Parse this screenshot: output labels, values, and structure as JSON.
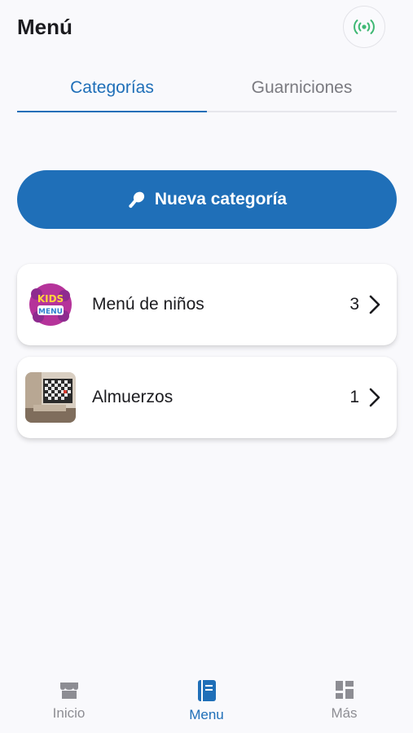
{
  "header": {
    "title": "Menú"
  },
  "tabs": [
    {
      "label": "Categorías",
      "active": true
    },
    {
      "label": "Guarniciones",
      "active": false
    }
  ],
  "new_category_button": {
    "label": "Nueva categoría"
  },
  "categories": [
    {
      "name": "Menú de niños",
      "count": "3",
      "thumb_text": "KIDS MENU"
    },
    {
      "name": "Almuerzos",
      "count": "1"
    }
  ],
  "bottom_nav": [
    {
      "label": "Inicio",
      "icon": "store-icon",
      "active": false
    },
    {
      "label": "Menu",
      "icon": "book-icon",
      "active": true
    },
    {
      "label": "Más",
      "icon": "grid-icon",
      "active": false
    }
  ],
  "colors": {
    "primary": "#1f6fb8",
    "live_green": "#3fb874",
    "inactive": "#8d8d93"
  }
}
